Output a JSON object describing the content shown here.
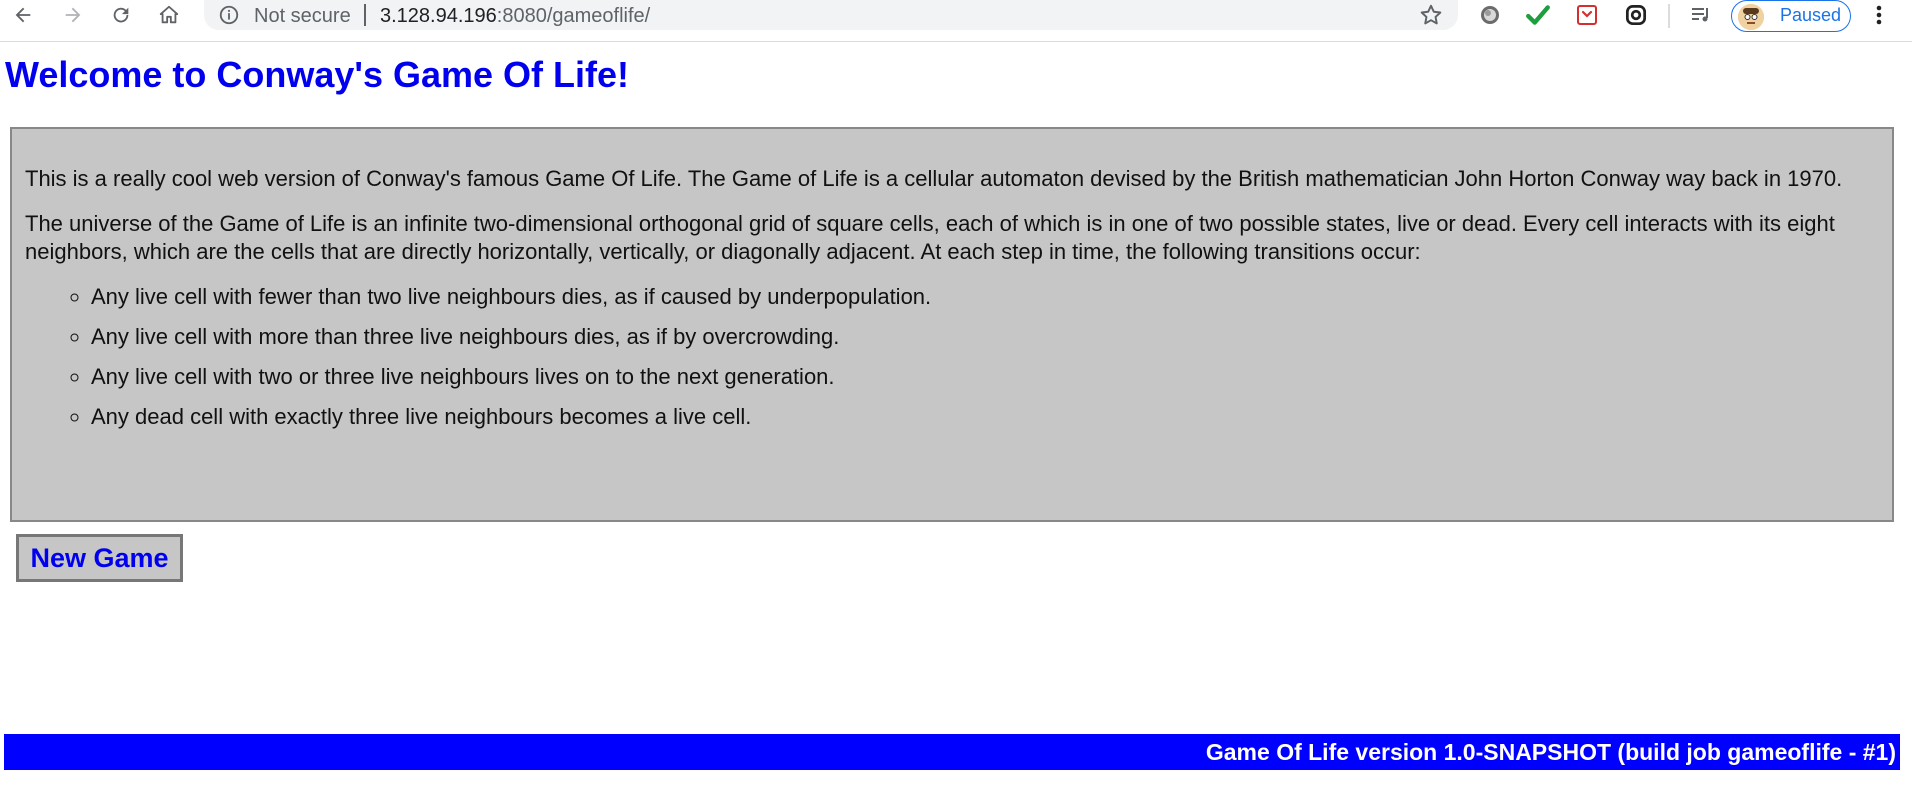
{
  "browser": {
    "security_label": "Not secure",
    "url_host": "3.128.94.196",
    "url_port_path": ":8080/gameoflife/",
    "profile_status": "Paused",
    "icons": [
      "back-icon",
      "forward-icon",
      "reload-icon",
      "home-icon",
      "info-icon",
      "star-icon",
      "extension-icon",
      "check-icon",
      "pocket-icon",
      "sync-icon",
      "media-icon",
      "menu-icon"
    ]
  },
  "page": {
    "title": "Welcome to Conway's Game Of Life!",
    "intro": "This is a really cool web version of Conway's famous Game Of Life. The Game of Life is a cellular automaton devised by the British mathematician John Horton Conway way back in 1970.",
    "universe": "The universe of the Game of Life is an infinite two-dimensional orthogonal grid of square cells, each of which is in one of two possible states, live or dead. Every cell interacts with its eight neighbors, which are the cells that are directly horizontally, vertically, or diagonally adjacent. At each step in time, the following transitions occur:",
    "rules": [
      "Any live cell with fewer than two live neighbours dies, as if caused by underpopulation.",
      "Any live cell with more than three live neighbours dies, as if by overcrowding.",
      "Any live cell with two or three live neighbours lives on to the next generation.",
      "Any dead cell with exactly three live neighbours becomes a live cell."
    ],
    "new_game_label": "New Game",
    "footer": "Game Of Life version 1.0-SNAPSHOT (build job gameoflife - #1)"
  },
  "colors": {
    "link_blue": "#0000ee",
    "panel_gray": "#c6c6c6",
    "footer_blue": "#0000ff"
  }
}
